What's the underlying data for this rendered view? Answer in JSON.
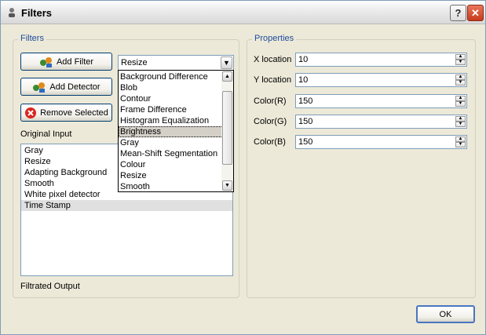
{
  "window": {
    "title": "Filters",
    "help_label": "?",
    "close_label": "✕"
  },
  "filters_group": {
    "title": "Filters",
    "add_filter_label": "Add Filter",
    "add_detector_label": "Add Detector",
    "remove_selected_label": "Remove Selected",
    "filter_type_value": "Resize",
    "filter_options": [
      "Background Difference",
      "Blob",
      "Contour",
      "Frame Difference",
      "Histogram Equalization",
      "Brightness",
      "Gray",
      "Mean-Shift Segmentation",
      "Colour",
      "Resize",
      "Smooth"
    ],
    "selected_option": "Brightness",
    "original_input_label": "Original Input",
    "pipeline": [
      "Gray",
      "Resize",
      "Adapting Background",
      "Smooth",
      "White pixel detector",
      "Time Stamp"
    ],
    "pipeline_selected": "Time Stamp",
    "filtrated_output_label": "Filtrated Output"
  },
  "properties_group": {
    "title": "Properties",
    "fields": [
      {
        "label": "X location",
        "value": "10"
      },
      {
        "label": "Y location",
        "value": "10"
      },
      {
        "label": "Color(R)",
        "value": "150"
      },
      {
        "label": "Color(G)",
        "value": "150"
      },
      {
        "label": "Color(B)",
        "value": "150"
      }
    ]
  },
  "footer": {
    "ok_label": "OK"
  },
  "icons": {
    "app": "person-icon",
    "add_filter": "add-filter-icon",
    "add_detector": "add-detector-icon",
    "remove": "remove-icon"
  },
  "colors": {
    "group_title": "#1e4b9e",
    "close_button": "#c8391a",
    "remove_icon": "#d9261c"
  }
}
